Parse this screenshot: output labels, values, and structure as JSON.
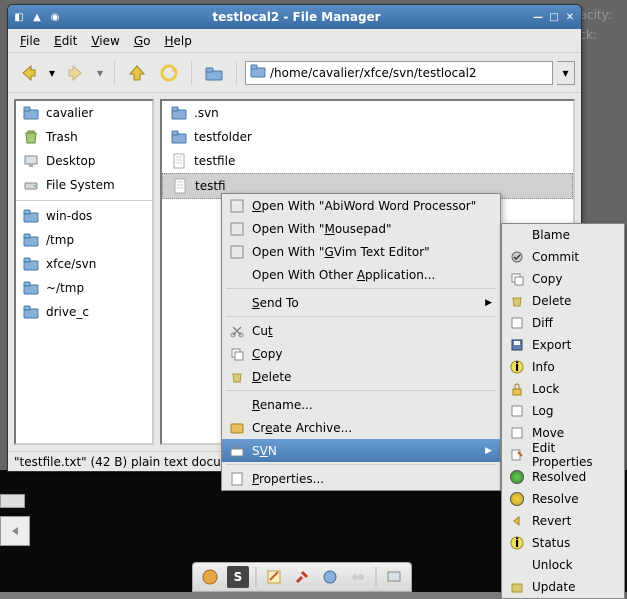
{
  "bg": {
    "opacity": "pacity:",
    "lock": "ock:"
  },
  "window": {
    "title": "testlocal2 - File Manager",
    "menu": [
      "File",
      "Edit",
      "View",
      "Go",
      "Help"
    ],
    "path": "/home/cavalier/xfce/svn/testlocal2",
    "sidebar": [
      {
        "icon": "folder",
        "label": "cavalier"
      },
      {
        "icon": "trash",
        "label": "Trash"
      },
      {
        "icon": "desktop",
        "label": "Desktop"
      },
      {
        "icon": "drive",
        "label": "File System"
      },
      {
        "sep": true
      },
      {
        "icon": "folder",
        "label": "win-dos"
      },
      {
        "icon": "folder",
        "label": "/tmp"
      },
      {
        "icon": "folder",
        "label": "xfce/svn"
      },
      {
        "icon": "folder",
        "label": "~/tmp"
      },
      {
        "icon": "folder",
        "label": "drive_c"
      }
    ],
    "files": [
      {
        "icon": "folder",
        "label": ".svn"
      },
      {
        "icon": "folder",
        "label": "testfolder"
      },
      {
        "icon": "file",
        "label": "testfile"
      },
      {
        "icon": "file",
        "label": "testfi",
        "sel": true
      }
    ],
    "status": "\"testfile.txt\" (42 B) plain text docu"
  },
  "ctx": {
    "items": [
      {
        "icon": "app",
        "label_pre": "",
        "label_ul": "O",
        "label_post": "pen With \"AbiWord Word Processor\""
      },
      {
        "icon": "app",
        "label_pre": "Open With \"",
        "label_ul": "M",
        "label_post": "ousepad\""
      },
      {
        "icon": "app",
        "label_pre": "Open With \"",
        "label_ul": "G",
        "label_post": "Vim Text Editor\""
      },
      {
        "plain": true,
        "label_pre": "Open With Other ",
        "label_ul": "A",
        "label_post": "pplication..."
      },
      {
        "sep": true
      },
      {
        "plain": true,
        "label_pre": "",
        "label_ul": "S",
        "label_post": "end To",
        "sub": true
      },
      {
        "sep": true
      },
      {
        "icon": "cut",
        "label_pre": "Cu",
        "label_ul": "t",
        "label_post": ""
      },
      {
        "icon": "copy",
        "label_pre": "",
        "label_ul": "C",
        "label_post": "opy"
      },
      {
        "icon": "delete",
        "label_pre": "",
        "label_ul": "D",
        "label_post": "elete"
      },
      {
        "sep": true
      },
      {
        "plain": true,
        "label_pre": "",
        "label_ul": "R",
        "label_post": "ename..."
      },
      {
        "icon": "archive",
        "label_pre": "Cr",
        "label_ul": "e",
        "label_post": "ate Archive..."
      },
      {
        "icon": "svn",
        "hl": true,
        "label_pre": "S",
        "label_ul": "V",
        "label_post": "N",
        "sub": true
      },
      {
        "sep": true
      },
      {
        "icon": "props",
        "label_pre": "",
        "label_ul": "P",
        "label_post": "roperties..."
      }
    ]
  },
  "svn": [
    {
      "label": "Blame"
    },
    {
      "icon": "commit",
      "label": "Commit"
    },
    {
      "icon": "copy",
      "label": "Copy"
    },
    {
      "icon": "delete",
      "label": "Delete"
    },
    {
      "icon": "diff",
      "label": "Diff"
    },
    {
      "icon": "save",
      "label": "Export"
    },
    {
      "icon": "info",
      "label": "Info"
    },
    {
      "icon": "lock",
      "label": "Lock"
    },
    {
      "icon": "log",
      "label": "Log"
    },
    {
      "icon": "move",
      "label": "Move"
    },
    {
      "icon": "edit",
      "label": "Edit Properties"
    },
    {
      "icon": "green",
      "label": "Resolved"
    },
    {
      "icon": "yellow",
      "label": "Resolve"
    },
    {
      "icon": "revert",
      "label": "Revert"
    },
    {
      "icon": "info",
      "label": "Status"
    },
    {
      "label": "Unlock"
    },
    {
      "icon": "update",
      "label": "Update"
    }
  ]
}
